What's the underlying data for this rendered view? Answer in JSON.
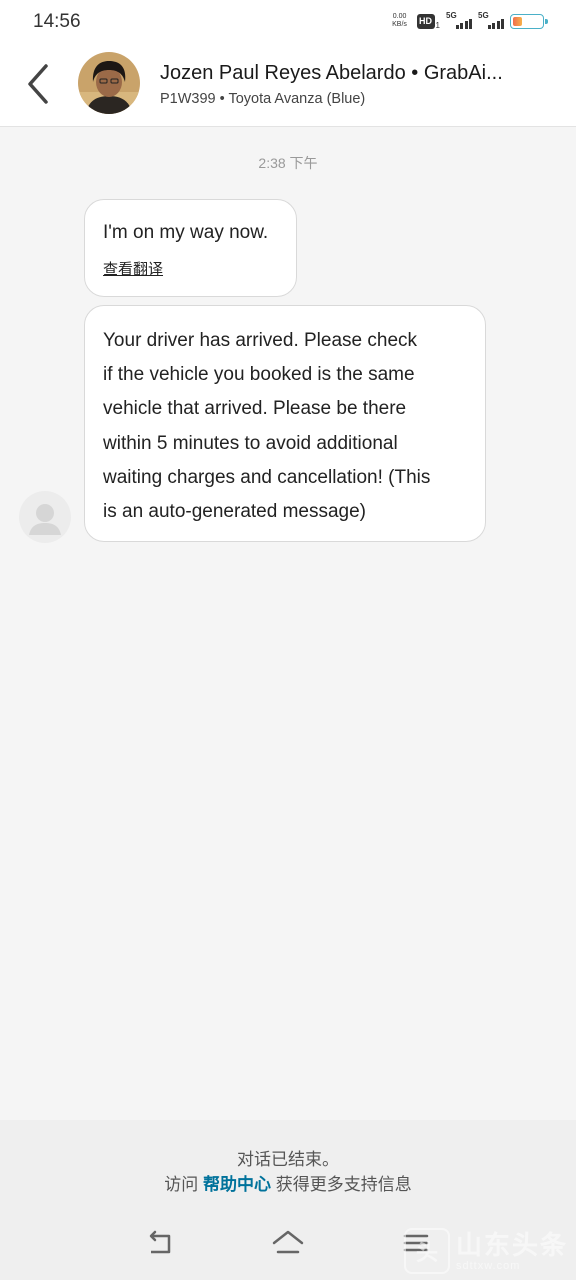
{
  "status_bar": {
    "time": "14:56",
    "net_speed_value": "0.00",
    "net_speed_unit": "KB/s",
    "hd_label": "HD",
    "hd_sub": "1",
    "signal1_label": "5G",
    "signal2_label": "5G",
    "battery_level": 0.35
  },
  "header": {
    "driver_name": "Jozen Paul Reyes Abelardo • GrabAi...",
    "vehicle_info": "P1W399 • Toyota Avanza (Blue)"
  },
  "chat": {
    "timestamp": "2:38 下午",
    "messages": [
      {
        "text": "I'm on my way now.",
        "translate_label": "查看翻译"
      },
      {
        "lines": [
          "Your driver has arrived. Please check",
          "if the vehicle you booked is the same",
          "vehicle that arrived. Please be there",
          "within 5 minutes to avoid additional",
          "waiting charges and cancellation! (This",
          "is an auto-generated message)"
        ]
      }
    ]
  },
  "footer": {
    "ended_text": "对话已结束。",
    "help_prefix": "访问",
    "help_link": "帮助中心",
    "help_suffix": "获得更多支持信息"
  },
  "colors": {
    "link": "#00729b",
    "background": "#f5f5f5",
    "bubble_border": "#d9d9d9"
  }
}
